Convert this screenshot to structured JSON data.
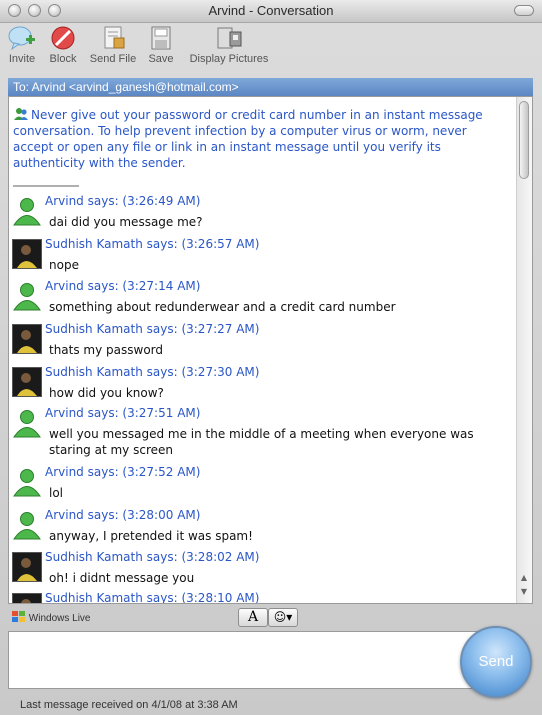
{
  "window": {
    "title": "Arvind - Conversation"
  },
  "toolbar": {
    "invite": "Invite",
    "block": "Block",
    "send_file": "Send File",
    "save": "Save",
    "display_pictures": "Display Pictures"
  },
  "to_line": "To: Arvind <arvind_ganesh@hotmail.com>",
  "warning": "Never give out your password or credit card number in an instant message conversation. To help prevent infection by a computer virus or worm, never accept or open any file or link in an instant message until you verify its authenticity with the sender.",
  "messages": [
    {
      "sender": "Arvind says: (3:26:49 AM)",
      "text": "dai did you message me?",
      "avatar": "buddy-icon"
    },
    {
      "sender": "Sudhish Kamath says: (3:26:57 AM)",
      "text": "nope",
      "avatar": "photo"
    },
    {
      "sender": "Arvind says: (3:27:14 AM)",
      "text": "something about redunderwear and a credit card number",
      "avatar": "buddy-icon"
    },
    {
      "sender": "Sudhish Kamath says: (3:27:27 AM)",
      "text": "thats my password",
      "avatar": "photo"
    },
    {
      "sender": "Sudhish Kamath says: (3:27:30 AM)",
      "text": "how did you know?",
      "avatar": "photo"
    },
    {
      "sender": "Arvind says: (3:27:51 AM)",
      "text": "well you messaged me in the middle of a meeting when everyone was staring at my screen",
      "avatar": "buddy-icon"
    },
    {
      "sender": "Arvind says: (3:27:52 AM)",
      "text": "lol",
      "avatar": "buddy-icon"
    },
    {
      "sender": "Arvind says: (3:28:00 AM)",
      "text": "anyway, I pretended it was spam!",
      "avatar": "buddy-icon"
    },
    {
      "sender": "Sudhish Kamath says: (3:28:02 AM)",
      "text": "oh! i didnt message you",
      "avatar": "photo"
    },
    {
      "sender": "Sudhish Kamath says: (3:28:10 AM)",
      "text": "",
      "avatar": "photo"
    }
  ],
  "bottom": {
    "brand": "Windows Live",
    "font_button": "A",
    "send_label": "Send",
    "status": "Last message received on 4/1/08 at 3:38 AM"
  },
  "colors": {
    "sender": "#2a56c6",
    "to_bar": "#6c95cd",
    "send_button": "#5d9ad8"
  }
}
